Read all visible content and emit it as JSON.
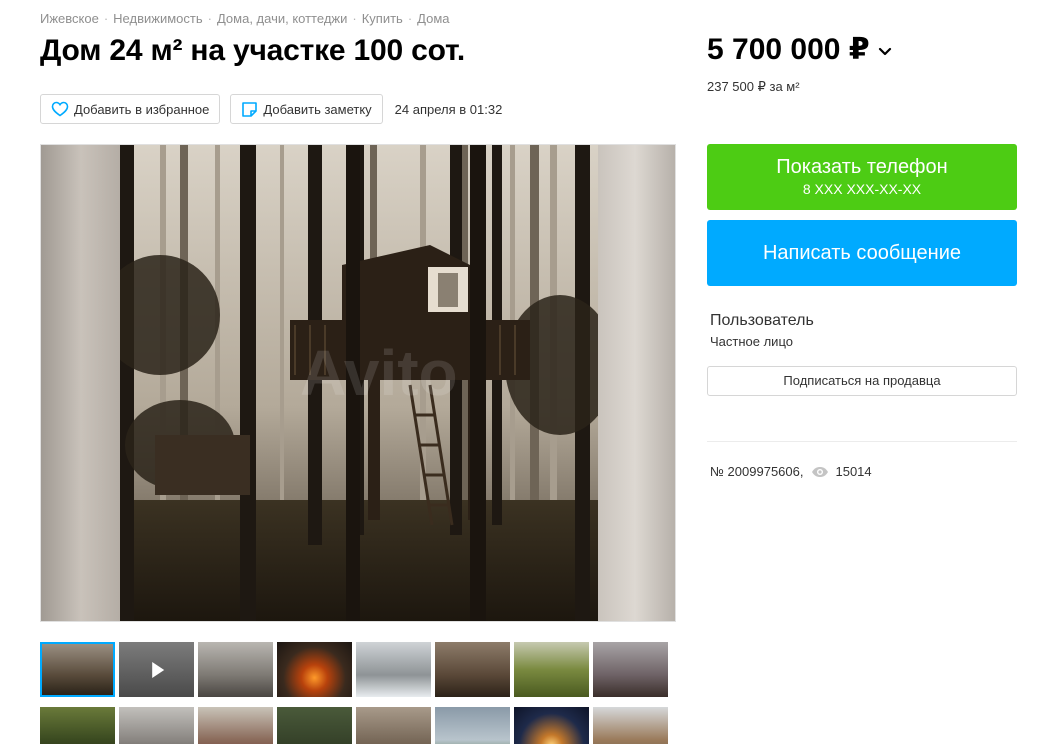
{
  "breadcrumb": [
    "Ижевское",
    "Недвижимость",
    "Дома, дачи, коттеджи",
    "Купить",
    "Дома"
  ],
  "breadcrumb_separator": "·",
  "title": "Дом 24 м² на участке 100 сот.",
  "actions": {
    "favorite_label": "Добавить в избранное",
    "note_label": "Добавить заметку",
    "date": "24 апреля в 01:32"
  },
  "price": {
    "value": "5 700 000 ₽",
    "per_m2": "237 500 ₽ за м²"
  },
  "contact": {
    "phone_label": "Показать телефон",
    "phone_masked": "8 XXX XXX-XX-XX",
    "message_label": "Написать сообщение"
  },
  "seller": {
    "name": "Пользователь",
    "type": "Частное лицо",
    "subscribe_label": "Подписаться на продавца"
  },
  "listing": {
    "number": "№ 2009975606,",
    "views": "15014"
  },
  "gallery": {
    "watermark": "Avito",
    "thumbnails_row1": [
      "treehouse-photo",
      "video-snow-forest",
      "foggy-road",
      "campfire",
      "snowy-trees",
      "pine-forest",
      "autumn-clearing",
      "treehouse-side"
    ],
    "thumbnails_row2": [
      "forest-path",
      "winter-forest",
      "cabin-fog",
      "dark-forest",
      "treehouse-stand",
      "cloudy-sky",
      "lantern-night",
      "horse"
    ]
  },
  "colors": {
    "green_button": "#4dcc14",
    "blue_button": "#00aaff",
    "accent": "#00aaff"
  },
  "icons": {
    "favorite": "heart-icon",
    "note": "note-icon",
    "views": "eye-icon",
    "price_toggle": "chevron-down-icon",
    "video": "play-icon"
  }
}
